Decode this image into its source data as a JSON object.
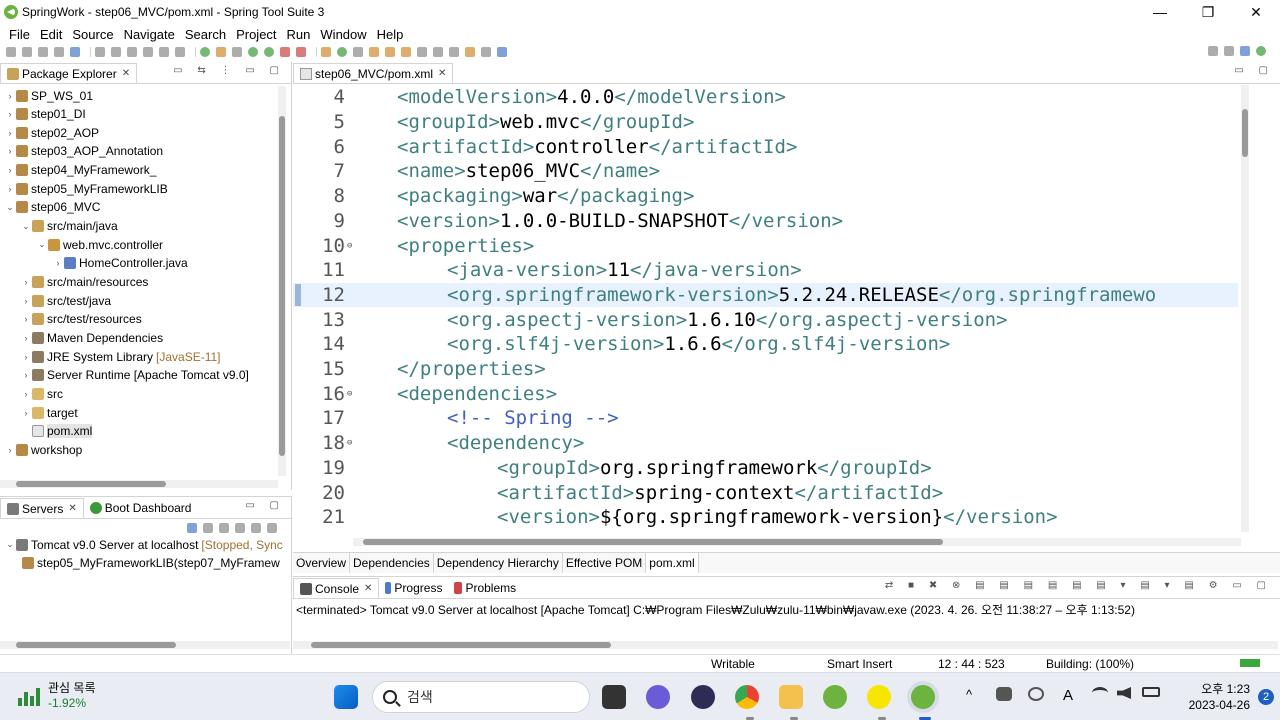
{
  "window": {
    "title": "SpringWork - step06_MVC/pom.xml - Spring Tool Suite 3",
    "minimize": "—",
    "restore": "❐",
    "close": "✕"
  },
  "menu": [
    "File",
    "Edit",
    "Source",
    "Navigate",
    "Search",
    "Project",
    "Run",
    "Window",
    "Help"
  ],
  "package_explorer": {
    "tab_label": "Package Explorer",
    "nodes": [
      {
        "label": "SP_WS_01",
        "decor": "",
        "depth": 0,
        "arrow": "›",
        "icon": "project-icon"
      },
      {
        "label": "step01_DI",
        "decor": "",
        "depth": 0,
        "arrow": "›",
        "icon": "project-icon"
      },
      {
        "label": "step02_AOP",
        "decor": "",
        "depth": 0,
        "arrow": "›",
        "icon": "project-icon"
      },
      {
        "label": "step03_AOP_Annotation",
        "decor": "",
        "depth": 0,
        "arrow": "›",
        "icon": "project-icon"
      },
      {
        "label": "step04_MyFramework_",
        "decor": "",
        "depth": 0,
        "arrow": "›",
        "icon": "project-icon"
      },
      {
        "label": "step05_MyFrameworkLIB",
        "decor": "",
        "depth": 0,
        "arrow": "›",
        "icon": "project-icon"
      },
      {
        "label": "step06_MVC",
        "decor": "",
        "depth": 0,
        "arrow": "⌄",
        "icon": "project-icon"
      },
      {
        "label": "src/main/java",
        "decor": "",
        "depth": 1,
        "arrow": "⌄",
        "icon": "source-folder-icon"
      },
      {
        "label": "web.mvc.controller",
        "decor": "",
        "depth": 2,
        "arrow": "⌄",
        "icon": "package-icon"
      },
      {
        "label": "HomeController.java",
        "decor": "",
        "depth": 3,
        "arrow": "›",
        "icon": "java-file-icon"
      },
      {
        "label": "src/main/resources",
        "decor": "",
        "depth": 1,
        "arrow": "›",
        "icon": "source-folder-icon"
      },
      {
        "label": "src/test/java",
        "decor": "",
        "depth": 1,
        "arrow": "›",
        "icon": "source-folder-icon"
      },
      {
        "label": "src/test/resources",
        "decor": "",
        "depth": 1,
        "arrow": "›",
        "icon": "source-folder-icon"
      },
      {
        "label": "Maven Dependencies",
        "decor": "",
        "depth": 1,
        "arrow": "›",
        "icon": "library-icon"
      },
      {
        "label": "JRE System Library",
        "decor": "[JavaSE-11]",
        "depth": 1,
        "arrow": "›",
        "icon": "library-icon"
      },
      {
        "label": "Server Runtime [Apache Tomcat v9.0]",
        "decor": "",
        "depth": 1,
        "arrow": "›",
        "icon": "library-icon"
      },
      {
        "label": "src",
        "decor": "",
        "depth": 1,
        "arrow": "›",
        "icon": "folder-icon"
      },
      {
        "label": "target",
        "decor": "",
        "depth": 1,
        "arrow": "›",
        "icon": "folder-icon"
      },
      {
        "label": "pom.xml",
        "decor": "",
        "depth": 1,
        "arrow": "",
        "icon": "xml-file-icon",
        "selected": true
      },
      {
        "label": "workshop",
        "decor": "",
        "depth": 0,
        "arrow": "›",
        "icon": "project-icon"
      }
    ]
  },
  "servers": {
    "tab_servers": "Servers",
    "tab_boot": "Boot Dashboard",
    "server_name": "Tomcat v9.0 Server at localhost",
    "server_state": "[Stopped, Sync",
    "module": "step05_MyFrameworkLIB(step07_MyFramew"
  },
  "editor": {
    "tab_label": "step06_MVC/pom.xml",
    "current_line": 12,
    "lines": [
      {
        "n": "4",
        "fold": "",
        "indent": 1,
        "parts": [
          [
            "tag",
            "<modelVersion>"
          ],
          [
            "txt",
            "4.0.0"
          ],
          [
            "tag",
            "</modelVersion>"
          ]
        ]
      },
      {
        "n": "5",
        "fold": "",
        "indent": 1,
        "parts": [
          [
            "tag",
            "<groupId>"
          ],
          [
            "txt",
            "web.mvc"
          ],
          [
            "tag",
            "</groupId>"
          ]
        ]
      },
      {
        "n": "6",
        "fold": "",
        "indent": 1,
        "parts": [
          [
            "tag",
            "<artifactId>"
          ],
          [
            "txt",
            "controller"
          ],
          [
            "tag",
            "</artifactId>"
          ]
        ]
      },
      {
        "n": "7",
        "fold": "",
        "indent": 1,
        "parts": [
          [
            "tag",
            "<name>"
          ],
          [
            "txt",
            "step06_MVC"
          ],
          [
            "tag",
            "</name>"
          ]
        ]
      },
      {
        "n": "8",
        "fold": "",
        "indent": 1,
        "parts": [
          [
            "tag",
            "<packaging>"
          ],
          [
            "txt",
            "war"
          ],
          [
            "tag",
            "</packaging>"
          ]
        ]
      },
      {
        "n": "9",
        "fold": "",
        "indent": 1,
        "parts": [
          [
            "tag",
            "<version>"
          ],
          [
            "txt",
            "1.0.0-BUILD-SNAPSHOT"
          ],
          [
            "tag",
            "</version>"
          ]
        ]
      },
      {
        "n": "10",
        "fold": "⊖",
        "indent": 1,
        "parts": [
          [
            "tag",
            "<properties>"
          ]
        ]
      },
      {
        "n": "11",
        "fold": "",
        "indent": 2,
        "parts": [
          [
            "tag",
            "<java-version>"
          ],
          [
            "txt",
            "11"
          ],
          [
            "tag",
            "</java-version>"
          ]
        ]
      },
      {
        "n": "12",
        "fold": "",
        "indent": 2,
        "parts": [
          [
            "tag",
            "<org.springframework-version>"
          ],
          [
            "txt",
            "5.2.24.RELEASE"
          ],
          [
            "tag",
            "</org.springframewo"
          ]
        ]
      },
      {
        "n": "13",
        "fold": "",
        "indent": 2,
        "parts": [
          [
            "tag",
            "<org.aspectj-version>"
          ],
          [
            "txt",
            "1.6.10"
          ],
          [
            "tag",
            "</org.aspectj-version>"
          ]
        ]
      },
      {
        "n": "14",
        "fold": "",
        "indent": 2,
        "parts": [
          [
            "tag",
            "<org.slf4j-version>"
          ],
          [
            "txt",
            "1.6.6"
          ],
          [
            "tag",
            "</org.slf4j-version>"
          ]
        ]
      },
      {
        "n": "15",
        "fold": "",
        "indent": 1,
        "parts": [
          [
            "tag",
            "</properties>"
          ]
        ]
      },
      {
        "n": "16",
        "fold": "⊖",
        "indent": 1,
        "parts": [
          [
            "tag",
            "<dependencies>"
          ]
        ]
      },
      {
        "n": "17",
        "fold": "",
        "indent": 2,
        "parts": [
          [
            "cmt",
            "<!-- Spring -->"
          ]
        ]
      },
      {
        "n": "18",
        "fold": "⊖",
        "indent": 2,
        "parts": [
          [
            "tag",
            "<dependency>"
          ]
        ]
      },
      {
        "n": "19",
        "fold": "",
        "indent": 3,
        "parts": [
          [
            "tag",
            "<groupId>"
          ],
          [
            "txt",
            "org.springframework"
          ],
          [
            "tag",
            "</groupId>"
          ]
        ]
      },
      {
        "n": "20",
        "fold": "",
        "indent": 3,
        "parts": [
          [
            "tag",
            "<artifactId>"
          ],
          [
            "txt",
            "spring-context"
          ],
          [
            "tag",
            "</artifactId>"
          ]
        ]
      },
      {
        "n": "21",
        "fold": "",
        "indent": 3,
        "parts": [
          [
            "tag",
            "<version>"
          ],
          [
            "txt",
            "${org.springframework-version}"
          ],
          [
            "tag",
            "</version>"
          ]
        ]
      }
    ],
    "bottom_tabs": [
      "Overview",
      "Dependencies",
      "Dependency Hierarchy",
      "Effective POM",
      "pom.xml"
    ],
    "active_bottom_tab": "pom.xml"
  },
  "console": {
    "tab_console": "Console",
    "tab_progress": "Progress",
    "tab_problems": "Problems",
    "message": "<terminated> Tomcat v9.0 Server at localhost [Apache Tomcat] C:₩Program Files₩Zulu₩zulu-11₩bin₩javaw.exe  (2023. 4. 26. 오전 11:38:27 – 오후 1:13:52)"
  },
  "status": {
    "writable": "Writable",
    "insert_mode": "Smart Insert",
    "position": "12 : 44 : 523",
    "building": "Building: (100%)"
  },
  "taskbar": {
    "widget_title": "관심 목록",
    "widget_change": "-1.92%",
    "search_placeholder": "검색",
    "time": "오후 1:23",
    "date": "2023-04-26",
    "notifications": "2",
    "tray_caret": "^",
    "tray_lang": "A"
  }
}
